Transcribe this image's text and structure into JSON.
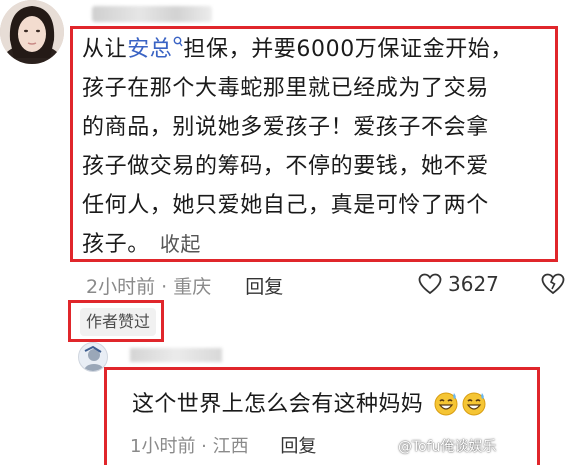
{
  "comment": {
    "text_before_mention": "从让",
    "mention": "安总",
    "text_after_mention": "担保，并要6000万保证金开始，\n孩子在那个大毒蛇那里就已经成为了交易\n的商品，别说她多爱孩子！爱孩子不会拿\n孩子做交易的筹码，不停的要钱，她不爱\n任何人，她只爱她自己，真是可怜了两个\n孩子。",
    "collapse_label": "收起",
    "time_location": "2小时前 · 重庆",
    "reply_label": "回复",
    "like_count": "3627",
    "author_liked_badge": "作者赞过"
  },
  "reply": {
    "text": "这个世界上怎么会有这种妈妈",
    "time_location": "1小时前 · 江西",
    "reply_label": "回复"
  },
  "watermark": "@Tofu俺谈娱乐",
  "colors": {
    "highlight_box": "#e0262b",
    "mention": "#3a63c4",
    "meta": "#8a8a8a"
  },
  "icons": [
    "search-mention-icon",
    "heart-icon",
    "dislike-heart-icon",
    "sweat-smile-emoji"
  ]
}
